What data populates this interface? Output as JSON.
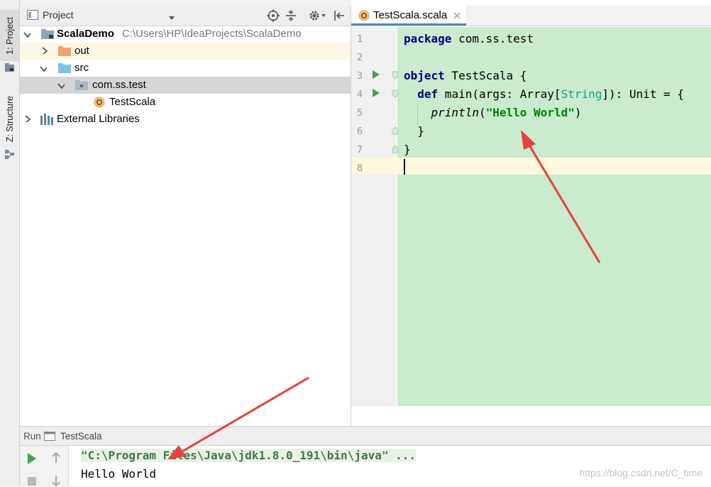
{
  "toolwindows": {
    "project_tab": "1: Project",
    "structure_tab": "Z: Structure"
  },
  "project": {
    "title": "Project",
    "tree": {
      "root": "ScalaDemo",
      "root_path": "C:\\Users\\HP\\IdeaProjects\\ScalaDemo",
      "out": "out",
      "src": "src",
      "package": "com.ss.test",
      "file": "TestScala",
      "libraries": "External Libraries"
    }
  },
  "editor": {
    "tab_label": "TestScala.scala",
    "line_numbers": [
      "1",
      "2",
      "3",
      "4",
      "5",
      "6",
      "7",
      "8"
    ],
    "code": {
      "l1_kw": "package",
      "l1_rest": " com.ss.test",
      "l3_kw": "object",
      "l3_rest": " TestScala {",
      "l4_indent": "  ",
      "l4_kw": "def",
      "l4_a": " main(args: Array[",
      "l4_type": "String",
      "l4_b": "]): Unit = {",
      "l5_indent": "    ",
      "l5_fn": "println",
      "l5_open": "(",
      "l5_str": "\"Hello World\"",
      "l5_close": ")",
      "l6": "  }",
      "l7": "}"
    }
  },
  "run": {
    "label": "Run",
    "config": "TestScala",
    "command": "\"C:\\Program Files\\Java\\jdk1.8.0_191\\bin\\java\" ...",
    "output": "Hello World"
  },
  "watermark": "https://blog.csdn.net/C_time",
  "colors": {
    "code_bg": "#c9ebce",
    "keyword": "#000080",
    "string": "#008000",
    "type": "#20999d",
    "annotation_arrow": "#e8413b"
  }
}
